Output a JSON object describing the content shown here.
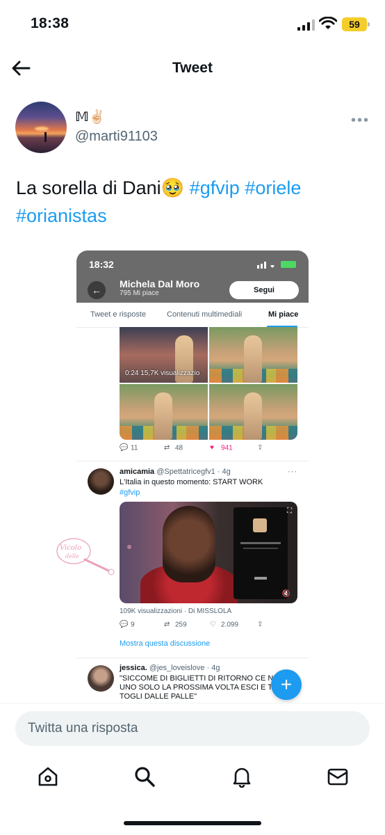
{
  "status_bar": {
    "time": "18:38",
    "battery": "59"
  },
  "header": {
    "title": "Tweet"
  },
  "tweet": {
    "author_name": "𝕄✌🏻",
    "author_handle": "@marti91103",
    "text_plain": "La sorella di Dani🥹 ",
    "hashtags": [
      "#gfvip",
      "#oriele",
      "#orianistas"
    ]
  },
  "embed": {
    "time": "18:32",
    "profile_name": "Michela Dal Moro",
    "profile_likes": "795 Mi piace",
    "follow_label": "Segui",
    "tabs": [
      "Tweet e risposte",
      "Contenuti multimediali",
      "Mi piace"
    ],
    "video_label": "0:24   15,7K visualizzazio",
    "tweet1_actions": {
      "replies": "11",
      "retweets": "48",
      "likes": "941"
    },
    "tweet2": {
      "name": "amicamia",
      "handle": "@Spettatricegfv1 · 4g",
      "text": "L'Italia in questo momento: START WORK",
      "hashtag": "#gfvip",
      "views": "109K visualizzazioni · Di MISSLOLA",
      "replies": "9",
      "retweets": "259",
      "likes": "2.099",
      "show_thread": "Mostra questa discussione"
    },
    "tweet3": {
      "name": "jessica.",
      "handle": "@jes_loveislove · 4g",
      "lines": [
        "\"SICCOME DI BIGLIETTI DI RITORNO CE N",
        "UNO SOLO LA PROSSIMA VOLTA ESCI E T",
        "TOGLI DALLE PALLE\""
      ]
    }
  },
  "fab_label": "+",
  "reply_placeholder": "Twitta una risposta",
  "nav": [
    "home-icon",
    "search-icon",
    "bell-icon",
    "mail-icon"
  ],
  "colors": {
    "accent": "#1d9bf0",
    "like": "#f91880",
    "battery": "#f4cd2a"
  }
}
